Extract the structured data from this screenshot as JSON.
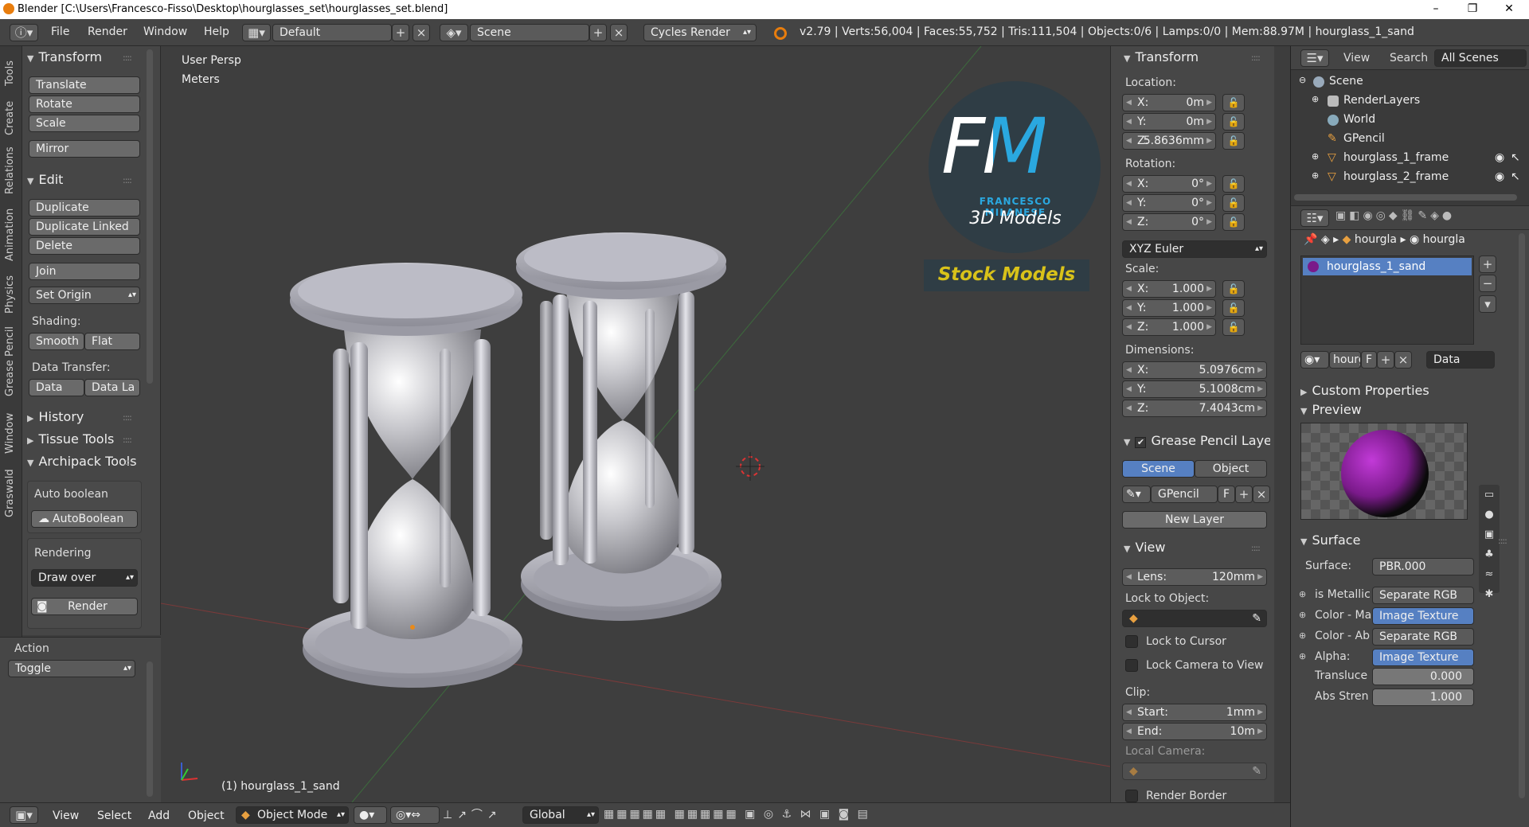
{
  "window": {
    "title": "Blender [C:\\Users\\Francesco-Fisso\\Desktop\\hourglasses_set\\hourglasses_set.blend]",
    "min": "–",
    "max": "❐",
    "close": "✕"
  },
  "infobar": {
    "menus": [
      "File",
      "Render",
      "Window",
      "Help"
    ],
    "layout": "Default",
    "scene": "Scene",
    "engine": "Cycles Render",
    "stats": "v2.79 | Verts:56,004 | Faces:55,752 | Tris:111,504 | Objects:0/6 | Lamps:0/0 | Mem:88.97M | hourglass_1_sand"
  },
  "tabs": [
    "Tools",
    "Create",
    "Relations",
    "Animation",
    "Physics",
    "Grease Pencil",
    "Window",
    "Graswald"
  ],
  "toolshelf": {
    "transform": {
      "title": "Transform",
      "buttons": [
        "Translate",
        "Rotate",
        "Scale",
        "Mirror"
      ]
    },
    "edit": {
      "title": "Edit",
      "buttons": [
        "Duplicate",
        "Duplicate Linked",
        "Delete",
        "Join"
      ],
      "set_origin": "Set Origin",
      "shading_label": "Shading:",
      "smooth": "Smooth",
      "flat": "Flat",
      "data_transfer_label": "Data Transfer:",
      "data": "Data",
      "data_la": "Data La"
    },
    "history": "History",
    "tissue": "Tissue Tools",
    "archipack": {
      "title": "Archipack Tools",
      "auto_boolean_label": "Auto boolean",
      "auto_boolean_btn": "AutoBoolean",
      "rendering_label": "Rendering",
      "draw_over": "Draw over",
      "render": "Render"
    }
  },
  "action": {
    "label": "Action",
    "value": "Toggle"
  },
  "viewport": {
    "view": "User Persp",
    "units": "Meters",
    "object": "(1) hourglass_1_sand",
    "logo_fm": "FM",
    "logo_name": "FRANCESCO MILANESE",
    "logo_sub": "3D Models",
    "logo_stock": "Stock Models"
  },
  "npanel": {
    "transform": "Transform",
    "location_label": "Location:",
    "location": [
      {
        "k": "X:",
        "v": "0m"
      },
      {
        "k": "Y:",
        "v": "0m"
      },
      {
        "k": "Z:",
        "v": "5.8636mm"
      }
    ],
    "rotation_label": "Rotation:",
    "rotation": [
      {
        "k": "X:",
        "v": "0°"
      },
      {
        "k": "Y:",
        "v": "0°"
      },
      {
        "k": "Z:",
        "v": "0°"
      }
    ],
    "rot_mode": "XYZ Euler",
    "scale_label": "Scale:",
    "scale": [
      {
        "k": "X:",
        "v": "1.000"
      },
      {
        "k": "Y:",
        "v": "1.000"
      },
      {
        "k": "Z:",
        "v": "1.000"
      }
    ],
    "dimensions_label": "Dimensions:",
    "dimensions": [
      {
        "k": "X:",
        "v": "5.0976cm"
      },
      {
        "k": "Y:",
        "v": "5.1008cm"
      },
      {
        "k": "Z:",
        "v": "7.4043cm"
      }
    ],
    "gp_layer": "Grease Pencil Layer",
    "gp_scene": "Scene",
    "gp_object": "Object",
    "gp_name": "GPencil",
    "gp_f": "F",
    "new_layer": "New Layer",
    "view": "View",
    "lens_k": "Lens:",
    "lens_v": "120mm",
    "lock_object": "Lock to Object:",
    "lock_cursor": "Lock to Cursor",
    "lock_camera": "Lock Camera to View",
    "clip": "Clip:",
    "clip_start_k": "Start:",
    "clip_start_v": "1mm",
    "clip_end_k": "End:",
    "clip_end_v": "10m",
    "local_camera": "Local Camera:",
    "render_border": "Render Border"
  },
  "outliner": {
    "view": "View",
    "search": "Search",
    "all_scenes": "All Scenes",
    "items": [
      "Scene",
      "RenderLayers",
      "World",
      "GPencil",
      "hourglass_1_frame",
      "hourglass_2_frame"
    ]
  },
  "props": {
    "crumb1": "hourgla",
    "crumb2": "hourgla",
    "material": "hourglass_1_sand",
    "mat_field": "hourg",
    "mat_f": "F",
    "data": "Data",
    "custom_props": "Custom Properties",
    "preview": "Preview",
    "surface": "Surface",
    "rows": [
      {
        "k": "Surface:",
        "v": "PBR.000"
      },
      {
        "k": "is Metallic",
        "v": "Separate RGB"
      },
      {
        "k": "Color - Ma",
        "v": "Image Texture"
      },
      {
        "k": "Color - Ab",
        "v": "Separate RGB"
      },
      {
        "k": "Alpha:",
        "v": "Image Texture"
      },
      {
        "k": "Transluce",
        "v": "0.000"
      },
      {
        "k": "Abs Stren",
        "v": "1.000"
      }
    ]
  },
  "statusbar": {
    "view": "View",
    "select": "Select",
    "add": "Add",
    "object": "Object",
    "mode": "Object Mode",
    "orientation": "Global"
  },
  "colors": {
    "accent": "#5680c2",
    "logo_blue": "#2aa8e0",
    "logo_yellow": "#d8c21a"
  }
}
